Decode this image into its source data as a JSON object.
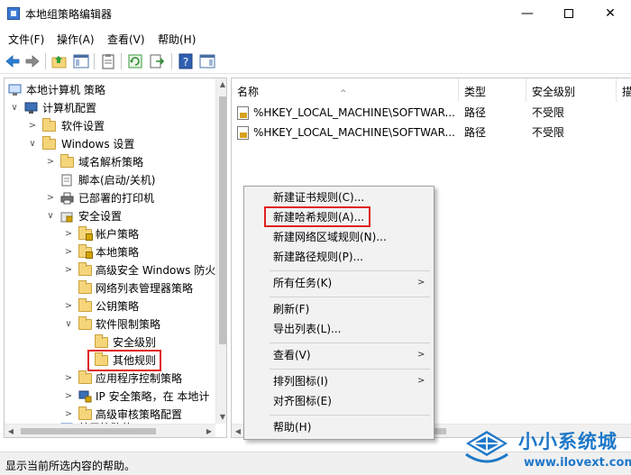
{
  "window": {
    "title": "本地组策略编辑器",
    "minimize_glyph": "—",
    "close_glyph": "✕"
  },
  "menubar": [
    {
      "label": "文件(F)"
    },
    {
      "label": "操作(A)"
    },
    {
      "label": "查看(V)"
    },
    {
      "label": "帮助(H)"
    }
  ],
  "toolbar": {
    "icons": [
      "back-arrow-icon",
      "forward-arrow-icon",
      "up-folder-icon",
      "show-hide-tree-icon",
      "properties-icon",
      "refresh-icon",
      "export-list-icon",
      "help-icon",
      "show-action-pane-icon"
    ]
  },
  "tree": {
    "items": [
      {
        "label": "本地计算机 策略",
        "icon": "computer-policy-icon",
        "chevron": ""
      },
      {
        "label": "计算机配置",
        "icon": "computer-icon",
        "chevron": "∨"
      },
      {
        "label": "软件设置",
        "icon": "folder-icon",
        "chevron": ">"
      },
      {
        "label": "Windows 设置",
        "icon": "folder-icon",
        "chevron": "∨"
      },
      {
        "label": "域名解析策略",
        "icon": "folder-icon",
        "chevron": ">"
      },
      {
        "label": "脚本(启动/关机)",
        "icon": "script-icon",
        "chevron": ""
      },
      {
        "label": "已部署的打印机",
        "icon": "printer-icon",
        "chevron": ">"
      },
      {
        "label": "安全设置",
        "icon": "security-settings-icon",
        "chevron": "∨"
      },
      {
        "label": "帐户策略",
        "icon": "folder-lock-icon",
        "chevron": ">"
      },
      {
        "label": "本地策略",
        "icon": "folder-lock-icon",
        "chevron": ">"
      },
      {
        "label": "高级安全 Windows 防火",
        "icon": "folder-icon",
        "chevron": ">"
      },
      {
        "label": "网络列表管理器策略",
        "icon": "folder-icon",
        "chevron": ""
      },
      {
        "label": "公钥策略",
        "icon": "folder-icon",
        "chevron": ">"
      },
      {
        "label": "软件限制策略",
        "icon": "folder-icon",
        "chevron": "∨"
      },
      {
        "label": "安全级别",
        "icon": "folder-icon",
        "chevron": ""
      },
      {
        "label": "其他规则",
        "icon": "folder-icon",
        "chevron": ""
      },
      {
        "label": "应用程序控制策略",
        "icon": "folder-icon",
        "chevron": ">"
      },
      {
        "label": "IP 安全策略，在 本地计",
        "icon": "ip-security-icon",
        "chevron": ">"
      },
      {
        "label": "高级审核策略配置",
        "icon": "folder-icon",
        "chevron": ">"
      },
      {
        "label": "基于策略的 QoS",
        "icon": "qos-icon",
        "chevron": ">"
      }
    ]
  },
  "list": {
    "columns": [
      {
        "label": "名称"
      },
      {
        "label": "类型"
      },
      {
        "label": "安全级别"
      },
      {
        "label": "描"
      }
    ],
    "sort_glyph": "^",
    "rows": [
      {
        "name": "%HKEY_LOCAL_MACHINE\\SOFTWAR...",
        "type": "路径",
        "level": "不受限"
      },
      {
        "name": "%HKEY_LOCAL_MACHINE\\SOFTWAR...",
        "type": "路径",
        "level": "不受限"
      }
    ]
  },
  "context_menu": {
    "items": [
      {
        "label": "新建证书规则(C)...",
        "submenu": ""
      },
      {
        "label": "新建哈希规则(A)...",
        "submenu": ""
      },
      {
        "label": "新建网络区域规则(N)...",
        "submenu": ""
      },
      {
        "label": "新建路径规则(P)...",
        "submenu": ""
      },
      {
        "label": "所有任务(K)",
        "submenu": ">"
      },
      {
        "label": "刷新(F)",
        "submenu": ""
      },
      {
        "label": "导出列表(L)...",
        "submenu": ""
      },
      {
        "label": "查看(V)",
        "submenu": ">"
      },
      {
        "label": "排列图标(I)",
        "submenu": ">"
      },
      {
        "label": "对齐图标(E)",
        "submenu": ""
      },
      {
        "label": "帮助(H)",
        "submenu": ""
      }
    ]
  },
  "statusbar": {
    "text": "显示当前所选内容的帮助。"
  },
  "watermark": {
    "title": "小小系统城",
    "url": "www.ilovext.com",
    "logo": "windows-logo-icon"
  },
  "colors": {
    "highlight_red": "#e02020",
    "watermark_blue": "#1e78c8",
    "folder_yellow": "#f6d57a"
  }
}
